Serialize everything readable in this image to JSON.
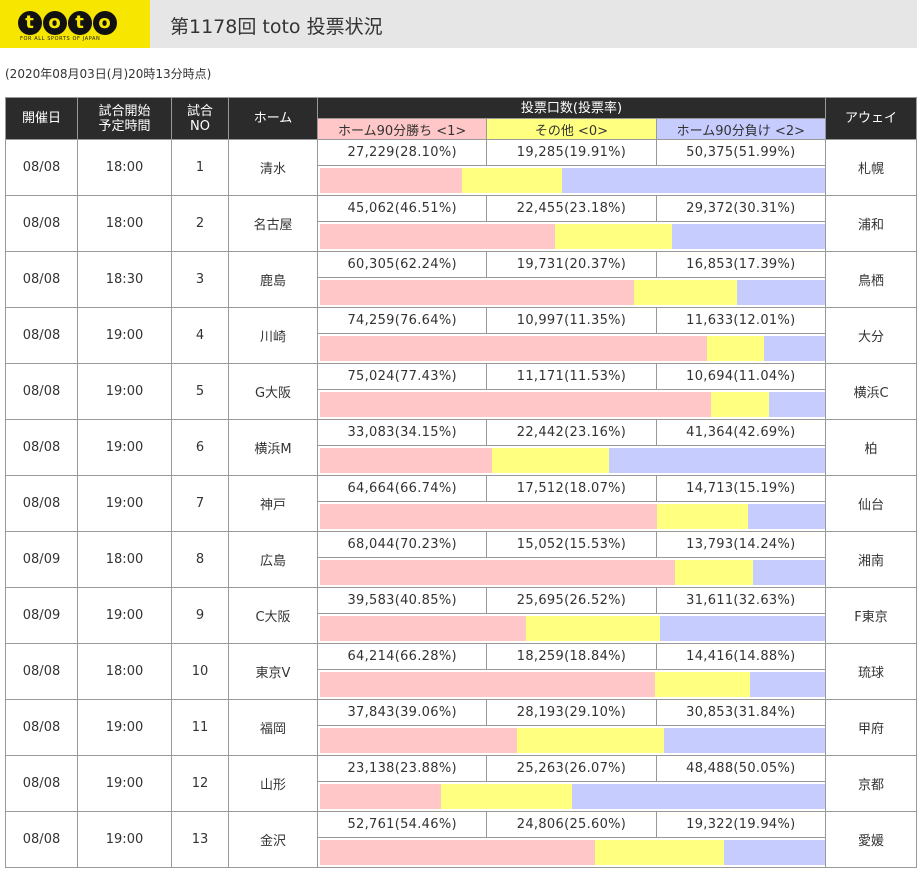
{
  "logo": {
    "text": "toto",
    "tagline": "FOR ALL SPORTS OF JAPAN"
  },
  "page_title": "第1178回 toto 投票状況",
  "timestamp": "(2020年08月03日(月)20時13分時点)",
  "colors": {
    "home": "#ffc7c7",
    "draw": "#ffff80",
    "away": "#c7ccff",
    "header_bg": "#2b2b2b",
    "logo_bg": "#f7e600"
  },
  "table": {
    "headers": {
      "date": "開催日",
      "time_line1": "試合開始",
      "time_line2": "予定時間",
      "no_line1": "試合",
      "no_line2": "NO",
      "home": "ホーム",
      "votes": "投票口数(投票率)",
      "home_win": "ホーム90分勝ち <1>",
      "draw": "その他 <0>",
      "away_win": "ホーム90分負け <2>",
      "away": "アウェイ"
    },
    "rows": [
      {
        "date": "08/08",
        "time": "18:00",
        "no": "1",
        "home": "清水",
        "away": "札幌",
        "v1": "27,229(28.10%)",
        "v0": "19,285(19.91%)",
        "v2": "50,375(51.99%)",
        "p1": 28.1,
        "p0": 19.91,
        "p2": 51.99
      },
      {
        "date": "08/08",
        "time": "18:00",
        "no": "2",
        "home": "名古屋",
        "away": "浦和",
        "v1": "45,062(46.51%)",
        "v0": "22,455(23.18%)",
        "v2": "29,372(30.31%)",
        "p1": 46.51,
        "p0": 23.18,
        "p2": 30.31
      },
      {
        "date": "08/08",
        "time": "18:30",
        "no": "3",
        "home": "鹿島",
        "away": "鳥栖",
        "v1": "60,305(62.24%)",
        "v0": "19,731(20.37%)",
        "v2": "16,853(17.39%)",
        "p1": 62.24,
        "p0": 20.37,
        "p2": 17.39
      },
      {
        "date": "08/08",
        "time": "19:00",
        "no": "4",
        "home": "川崎",
        "away": "大分",
        "v1": "74,259(76.64%)",
        "v0": "10,997(11.35%)",
        "v2": "11,633(12.01%)",
        "p1": 76.64,
        "p0": 11.35,
        "p2": 12.01
      },
      {
        "date": "08/08",
        "time": "19:00",
        "no": "5",
        "home": "G大阪",
        "away": "横浜C",
        "v1": "75,024(77.43%)",
        "v0": "11,171(11.53%)",
        "v2": "10,694(11.04%)",
        "p1": 77.43,
        "p0": 11.53,
        "p2": 11.04
      },
      {
        "date": "08/08",
        "time": "19:00",
        "no": "6",
        "home": "横浜M",
        "away": "柏",
        "v1": "33,083(34.15%)",
        "v0": "22,442(23.16%)",
        "v2": "41,364(42.69%)",
        "p1": 34.15,
        "p0": 23.16,
        "p2": 42.69
      },
      {
        "date": "08/08",
        "time": "19:00",
        "no": "7",
        "home": "神戸",
        "away": "仙台",
        "v1": "64,664(66.74%)",
        "v0": "17,512(18.07%)",
        "v2": "14,713(15.19%)",
        "p1": 66.74,
        "p0": 18.07,
        "p2": 15.19
      },
      {
        "date": "08/09",
        "time": "18:00",
        "no": "8",
        "home": "広島",
        "away": "湘南",
        "v1": "68,044(70.23%)",
        "v0": "15,052(15.53%)",
        "v2": "13,793(14.24%)",
        "p1": 70.23,
        "p0": 15.53,
        "p2": 14.24
      },
      {
        "date": "08/09",
        "time": "19:00",
        "no": "9",
        "home": "C大阪",
        "away": "F東京",
        "v1": "39,583(40.85%)",
        "v0": "25,695(26.52%)",
        "v2": "31,611(32.63%)",
        "p1": 40.85,
        "p0": 26.52,
        "p2": 32.63
      },
      {
        "date": "08/08",
        "time": "18:00",
        "no": "10",
        "home": "東京V",
        "away": "琉球",
        "v1": "64,214(66.28%)",
        "v0": "18,259(18.84%)",
        "v2": "14,416(14.88%)",
        "p1": 66.28,
        "p0": 18.84,
        "p2": 14.88
      },
      {
        "date": "08/08",
        "time": "19:00",
        "no": "11",
        "home": "福岡",
        "away": "甲府",
        "v1": "37,843(39.06%)",
        "v0": "28,193(29.10%)",
        "v2": "30,853(31.84%)",
        "p1": 39.06,
        "p0": 29.1,
        "p2": 31.84
      },
      {
        "date": "08/08",
        "time": "19:00",
        "no": "12",
        "home": "山形",
        "away": "京都",
        "v1": "23,138(23.88%)",
        "v0": "25,263(26.07%)",
        "v2": "48,488(50.05%)",
        "p1": 23.88,
        "p0": 26.07,
        "p2": 50.05
      },
      {
        "date": "08/08",
        "time": "19:00",
        "no": "13",
        "home": "金沢",
        "away": "愛媛",
        "v1": "52,761(54.46%)",
        "v0": "24,806(25.60%)",
        "v2": "19,322(19.94%)",
        "p1": 54.46,
        "p0": 25.6,
        "p2": 19.94
      }
    ]
  }
}
